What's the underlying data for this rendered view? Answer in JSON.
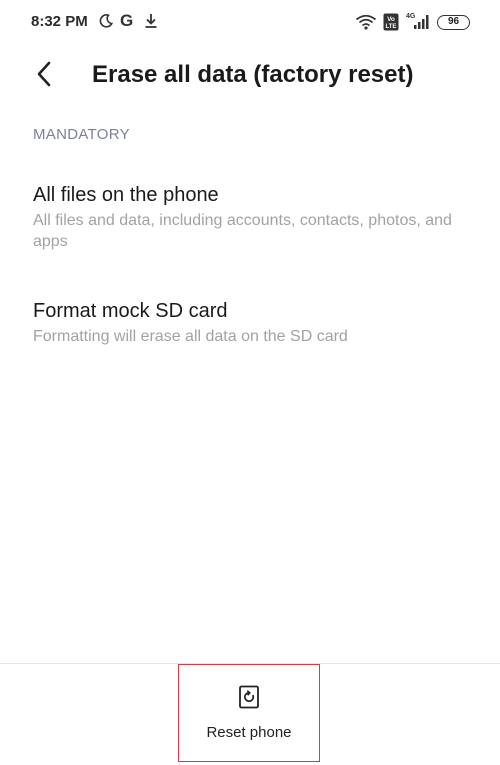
{
  "status_bar": {
    "time": "8:32 PM",
    "g_letter": "G",
    "battery": "96",
    "network": "4G",
    "volte": "Vo LTE"
  },
  "header": {
    "title": "Erase all data (factory reset)",
    "back_icon": "chevron-left-icon"
  },
  "section": {
    "label": "MANDATORY"
  },
  "items": [
    {
      "title": "All files on the phone",
      "description": "All files and data, including accounts, contacts, photos, and apps"
    },
    {
      "title": "Format mock SD card",
      "description": "Formatting will erase all data on the SD card"
    }
  ],
  "action": {
    "label": "Reset phone",
    "icon": "reset-phone-icon",
    "highlight_color": "#c9424a"
  },
  "colors": {
    "section_header": "#7d7fa0",
    "description": "#a2a2a2",
    "text": "#1a1a1a"
  }
}
